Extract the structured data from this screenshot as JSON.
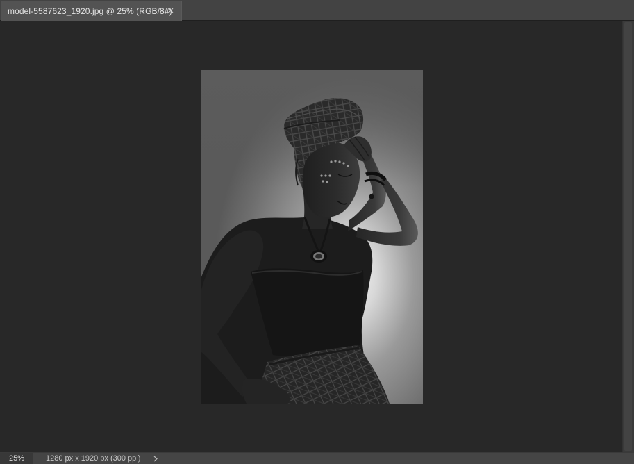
{
  "tab": {
    "title": "model-5587623_1920.jpg @ 25% (RGB/8#)",
    "close_icon": "close-icon"
  },
  "document": {
    "image": "portrait-of-woman-in-headwrap-grayscale"
  },
  "status": {
    "zoom": "25%",
    "info": "1280 px x 1920 px (300 ppi)",
    "arrow_icon": "chevron-right-icon"
  },
  "colors": {
    "workspace": "#282828",
    "tabbar": "#434343",
    "active_tab": "#535353",
    "statusbar": "#454545"
  }
}
